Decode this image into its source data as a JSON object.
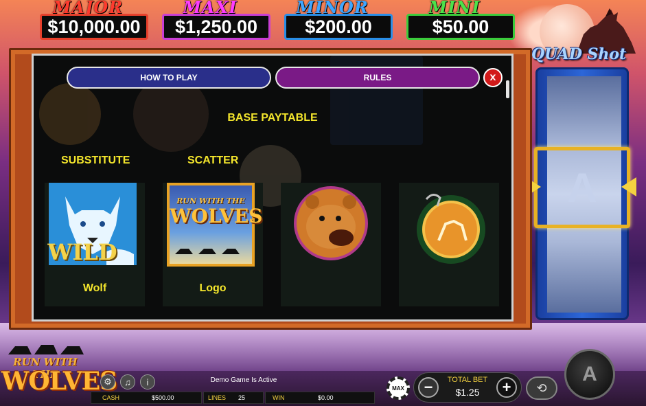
{
  "jackpots": [
    {
      "name": "MAJOR",
      "amount": "$10,000.00"
    },
    {
      "name": "MAXI",
      "amount": "$1,250.00"
    },
    {
      "name": "MINOR",
      "amount": "$200.00"
    },
    {
      "name": "MINI",
      "amount": "$50.00"
    }
  ],
  "brand": {
    "quadshot": "QUAD Shot",
    "game_logo_top": "RUN WITH THE",
    "game_logo_main": "WOLVES"
  },
  "modal": {
    "tabs": {
      "how_to_play": "HOW TO PLAY",
      "rules": "RULES"
    },
    "close_glyph": "x",
    "paytable_title": "BASE PAYTABLE",
    "labels": {
      "substitute": "SUBSTITUTE",
      "scatter": "SCATTER"
    },
    "symbols": [
      {
        "name": "Wolf",
        "art_text": "WILD",
        "icon": "wolf-wild-icon"
      },
      {
        "name": "Logo",
        "art_text_top": "RUN WITH THE",
        "art_text_main": "WOLVES",
        "icon": "logo-scatter-icon"
      },
      {
        "name": "",
        "icon": "bear-icon"
      },
      {
        "name": "",
        "icon": "dreamcatcher-medallion-icon"
      }
    ]
  },
  "bonus_reel": {
    "symbol": "A"
  },
  "controls": {
    "demo_status": "Demo Game Is Active",
    "cash_label": "CASH",
    "cash_value": "$500.00",
    "lines_label": "LINES",
    "lines_value": "25",
    "win_label": "WIN",
    "win_value": "$0.00",
    "max_label": "MAX",
    "total_bet_label": "TOTAL BET",
    "total_bet_value": "$1.25",
    "minus_glyph": "−",
    "plus_glyph": "+",
    "spin_glyph": "A"
  },
  "colors": {
    "accent_yellow": "#f4e62c",
    "tab_how": "#2a2f8a",
    "tab_rules": "#7a1a86",
    "close_red": "#d21a1a"
  }
}
